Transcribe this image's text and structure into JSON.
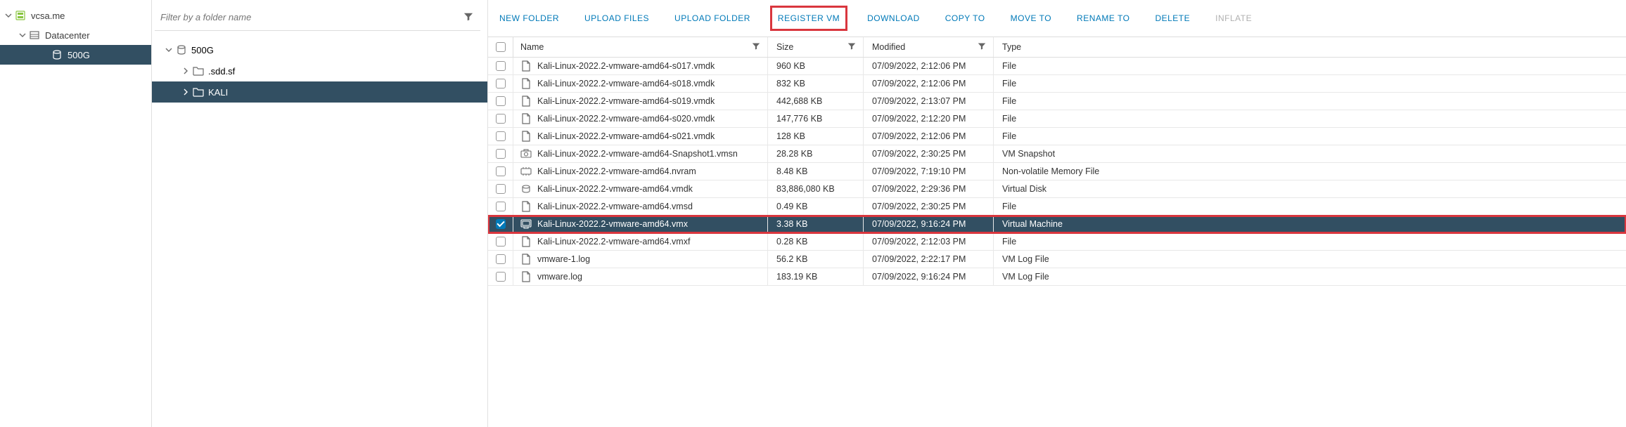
{
  "nav": {
    "items": [
      {
        "label": "vcsa.me",
        "level": 1,
        "caret": "down",
        "icon": "host",
        "selected": false
      },
      {
        "label": "Datacenter",
        "level": 2,
        "caret": "down",
        "icon": "datacenter",
        "selected": false
      },
      {
        "label": "500G",
        "level": 3,
        "caret": "none",
        "icon": "datastore",
        "selected": true
      }
    ]
  },
  "filter": {
    "placeholder": "Filter by a folder name"
  },
  "folderTree": {
    "items": [
      {
        "label": "500G",
        "level": 0,
        "caret": "down",
        "icon": "datastore",
        "selected": false
      },
      {
        "label": ".sdd.sf",
        "level": 1,
        "caret": "right",
        "icon": "folder",
        "selected": false
      },
      {
        "label": "KALI",
        "level": 1,
        "caret": "right",
        "icon": "folder",
        "selected": true
      }
    ]
  },
  "toolbar": {
    "buttons": [
      {
        "label": "NEW FOLDER",
        "state": "normal"
      },
      {
        "label": "UPLOAD FILES",
        "state": "normal"
      },
      {
        "label": "UPLOAD FOLDER",
        "state": "normal"
      },
      {
        "label": "REGISTER VM",
        "state": "boxed"
      },
      {
        "label": "DOWNLOAD",
        "state": "normal"
      },
      {
        "label": "COPY TO",
        "state": "normal"
      },
      {
        "label": "MOVE TO",
        "state": "normal"
      },
      {
        "label": "RENAME TO",
        "state": "normal"
      },
      {
        "label": "DELETE",
        "state": "normal"
      },
      {
        "label": "INFLATE",
        "state": "disabled"
      }
    ]
  },
  "table": {
    "columns": {
      "name": "Name",
      "size": "Size",
      "modified": "Modified",
      "type": "Type"
    },
    "rows": [
      {
        "name": "Kali-Linux-2022.2-vmware-amd64-s017.vmdk",
        "size": "960 KB",
        "modified": "07/09/2022, 2:12:06 PM",
        "type": "File",
        "icon": "file",
        "selected": false
      },
      {
        "name": "Kali-Linux-2022.2-vmware-amd64-s018.vmdk",
        "size": "832 KB",
        "modified": "07/09/2022, 2:12:06 PM",
        "type": "File",
        "icon": "file",
        "selected": false
      },
      {
        "name": "Kali-Linux-2022.2-vmware-amd64-s019.vmdk",
        "size": "442,688 KB",
        "modified": "07/09/2022, 2:13:07 PM",
        "type": "File",
        "icon": "file",
        "selected": false
      },
      {
        "name": "Kali-Linux-2022.2-vmware-amd64-s020.vmdk",
        "size": "147,776 KB",
        "modified": "07/09/2022, 2:12:20 PM",
        "type": "File",
        "icon": "file",
        "selected": false
      },
      {
        "name": "Kali-Linux-2022.2-vmware-amd64-s021.vmdk",
        "size": "128 KB",
        "modified": "07/09/2022, 2:12:06 PM",
        "type": "File",
        "icon": "file",
        "selected": false
      },
      {
        "name": "Kali-Linux-2022.2-vmware-amd64-Snapshot1.vmsn",
        "size": "28.28 KB",
        "modified": "07/09/2022, 2:30:25 PM",
        "type": "VM Snapshot",
        "icon": "snapshot",
        "selected": false
      },
      {
        "name": "Kali-Linux-2022.2-vmware-amd64.nvram",
        "size": "8.48 KB",
        "modified": "07/09/2022, 7:19:10 PM",
        "type": "Non-volatile Memory File",
        "icon": "nvram",
        "selected": false
      },
      {
        "name": "Kali-Linux-2022.2-vmware-amd64.vmdk",
        "size": "83,886,080 KB",
        "modified": "07/09/2022, 2:29:36 PM",
        "type": "Virtual Disk",
        "icon": "disk",
        "selected": false
      },
      {
        "name": "Kali-Linux-2022.2-vmware-amd64.vmsd",
        "size": "0.49 KB",
        "modified": "07/09/2022, 2:30:25 PM",
        "type": "File",
        "icon": "file",
        "selected": false
      },
      {
        "name": "Kali-Linux-2022.2-vmware-amd64.vmx",
        "size": "3.38 KB",
        "modified": "07/09/2022, 9:16:24 PM",
        "type": "Virtual Machine",
        "icon": "vm",
        "selected": true
      },
      {
        "name": "Kali-Linux-2022.2-vmware-amd64.vmxf",
        "size": "0.28 KB",
        "modified": "07/09/2022, 2:12:03 PM",
        "type": "File",
        "icon": "file",
        "selected": false
      },
      {
        "name": "vmware-1.log",
        "size": "56.2 KB",
        "modified": "07/09/2022, 2:22:17 PM",
        "type": "VM Log File",
        "icon": "file",
        "selected": false
      },
      {
        "name": "vmware.log",
        "size": "183.19 KB",
        "modified": "07/09/2022, 9:16:24 PM",
        "type": "VM Log File",
        "icon": "file",
        "selected": false
      }
    ]
  }
}
